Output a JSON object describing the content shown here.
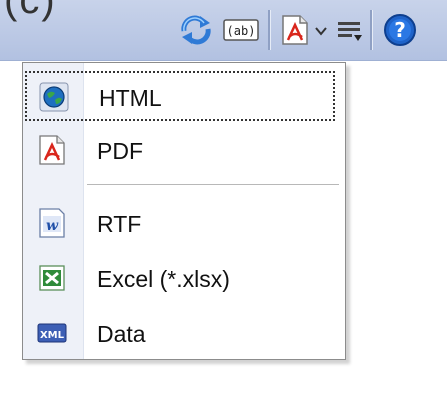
{
  "window": {
    "title_fragment": "(c)"
  },
  "toolbar": {
    "buttons": [
      {
        "name": "refresh-icon"
      },
      {
        "name": "text-field-icon"
      },
      {
        "name": "pdf-icon"
      },
      {
        "name": "chevron-down-icon"
      },
      {
        "name": "list-icon"
      },
      {
        "name": "help-icon"
      }
    ]
  },
  "export_menu": {
    "items": [
      {
        "label": "HTML",
        "icon": "globe-icon"
      },
      {
        "label": "PDF",
        "icon": "pdf-icon"
      },
      {
        "label": "RTF",
        "icon": "word-icon"
      },
      {
        "label": "Excel (*.xlsx)",
        "icon": "excel-icon"
      },
      {
        "label": "Data",
        "icon": "xml-icon"
      }
    ]
  }
}
